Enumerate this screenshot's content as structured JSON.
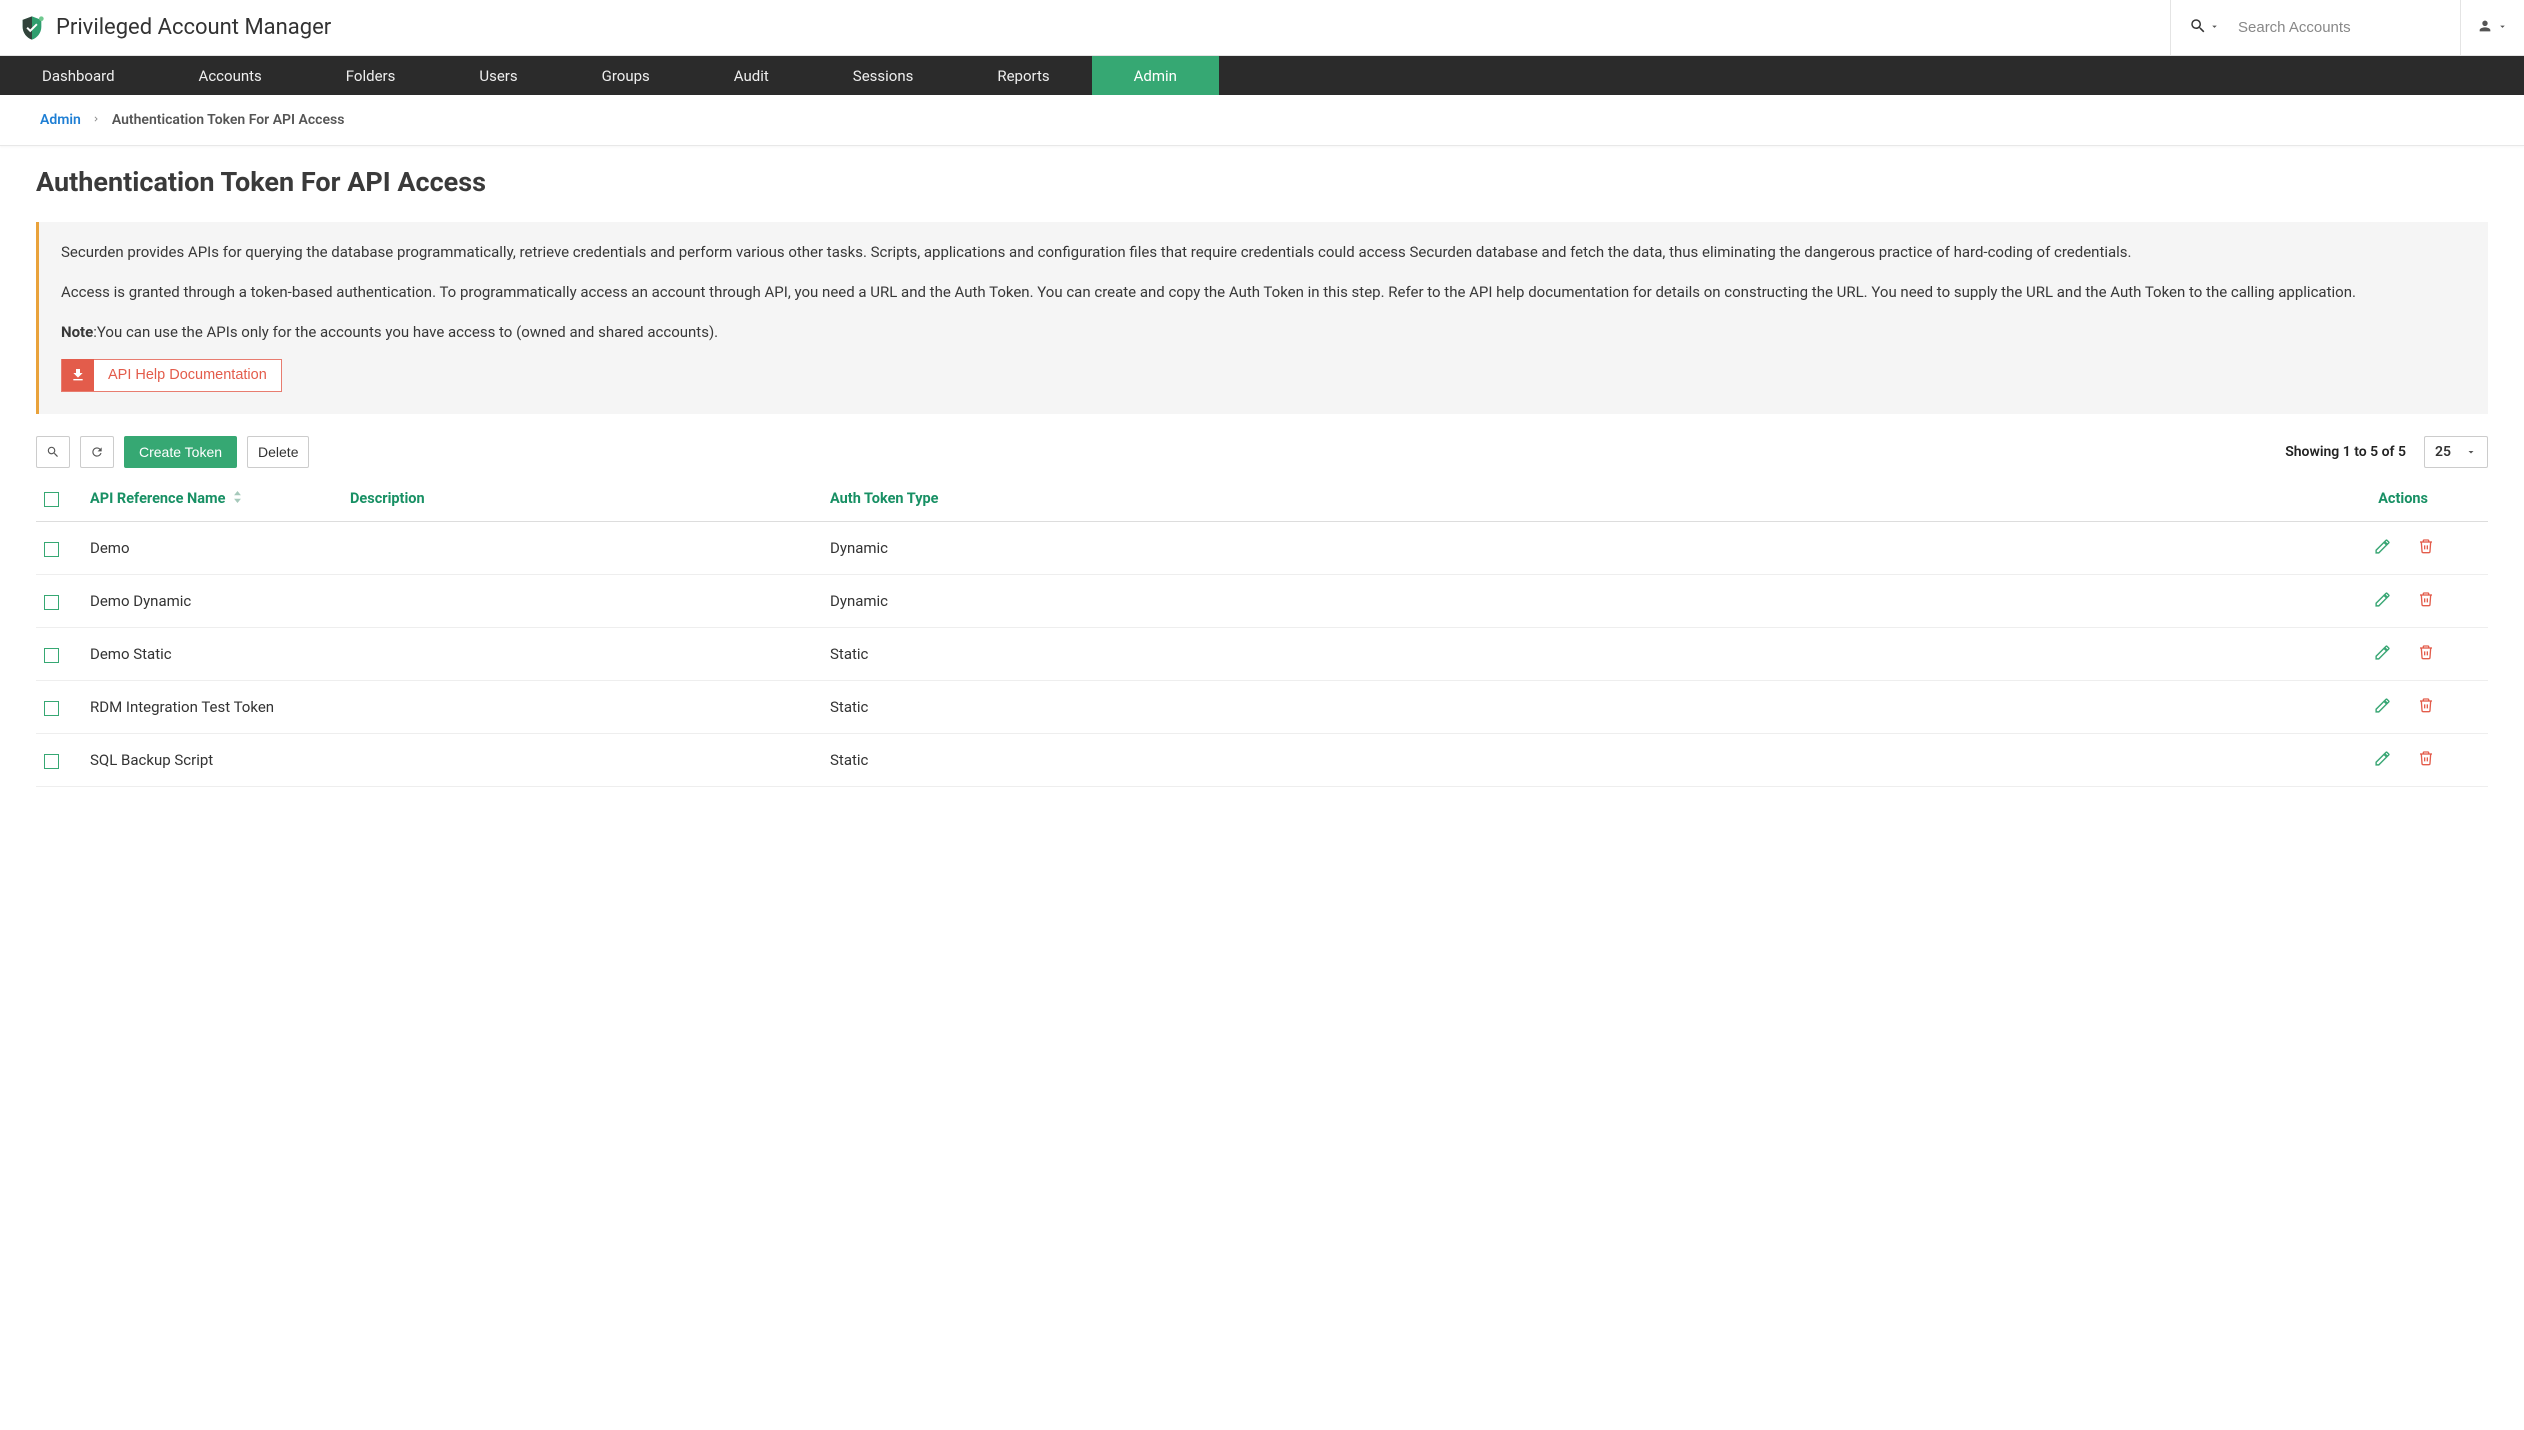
{
  "brand": {
    "title": "Privileged Account Manager"
  },
  "search": {
    "placeholder": "Search Accounts"
  },
  "nav": [
    {
      "label": "Dashboard",
      "active": false
    },
    {
      "label": "Accounts",
      "active": false
    },
    {
      "label": "Folders",
      "active": false
    },
    {
      "label": "Users",
      "active": false
    },
    {
      "label": "Groups",
      "active": false
    },
    {
      "label": "Audit",
      "active": false
    },
    {
      "label": "Sessions",
      "active": false
    },
    {
      "label": "Reports",
      "active": false
    },
    {
      "label": "Admin",
      "active": true
    }
  ],
  "breadcrumb": {
    "root": "Admin",
    "current": "Authentication Token For API Access"
  },
  "page_title": "Authentication Token For API Access",
  "info": {
    "p1": "Securden provides APIs for querying the database programmatically, retrieve credentials and perform various other tasks. Scripts, applications and configuration files that require credentials could access Securden database and fetch the data, thus eliminating the dangerous practice of hard-coding of credentials.",
    "p2": "Access is granted through a token-based authentication. To programmatically access an account through API, you need a URL and the Auth Token. You can create and copy the Auth Token in this step. Refer to the API help documentation for details on constructing the URL. You need to supply the URL and the Auth Token to the calling application.",
    "note_label": "Note",
    "note_text": ":You can use the APIs only for the accounts you have access to (owned and shared accounts).",
    "api_doc_button": "API Help Documentation"
  },
  "toolbar": {
    "create": "Create Token",
    "delete": "Delete",
    "showing": "Showing 1 to 5 of 5",
    "page_size": "25"
  },
  "columns": {
    "name": "API Reference Name",
    "description": "Description",
    "type": "Auth Token Type",
    "actions": "Actions"
  },
  "rows": [
    {
      "name": "Demo",
      "description": "",
      "type": "Dynamic"
    },
    {
      "name": "Demo Dynamic",
      "description": "",
      "type": "Dynamic"
    },
    {
      "name": "Demo Static",
      "description": "",
      "type": "Static"
    },
    {
      "name": "RDM Integration Test Token",
      "description": "",
      "type": "Static"
    },
    {
      "name": "SQL Backup Script",
      "description": "",
      "type": "Static"
    }
  ]
}
